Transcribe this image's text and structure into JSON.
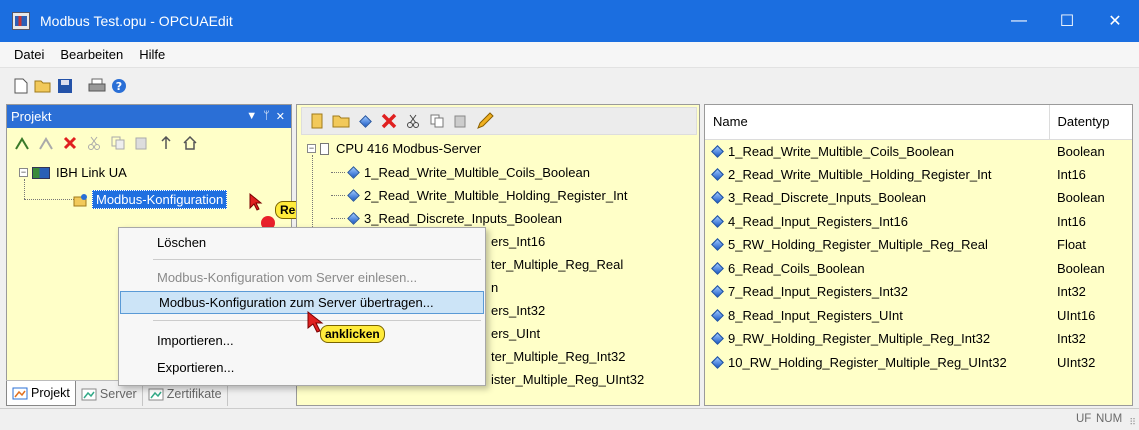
{
  "window": {
    "title": "Modbus Test.opu - OPCUAEdit",
    "minimize": "—",
    "maximize": "☐",
    "close": "✕"
  },
  "menu": [
    "Datei",
    "Bearbeiten",
    "Hilfe"
  ],
  "project_pane": {
    "title": "Projekt",
    "tree": {
      "root": "IBH Link UA",
      "child": "Modbus-Konfiguration"
    }
  },
  "bottom_tabs": [
    "Projekt",
    "Server",
    "Zertifikate"
  ],
  "server_tree": {
    "root": "CPU 416 Modbus-Server",
    "items": [
      "1_Read_Write_Multible_Coils_Boolean",
      "2_Read_Write_Multible_Holding_Register_Int",
      "3_Read_Discrete_Inputs_Boolean"
    ],
    "partial_items": [
      "ers_Int16",
      "ter_Multiple_Reg_Real",
      "n",
      "ers_Int32",
      "ers_UInt",
      "ter_Multiple_Reg_Int32",
      "ister_Multiple_Reg_UInt32"
    ]
  },
  "list_view": {
    "columns": [
      "Name",
      "Datentyp"
    ],
    "rows": [
      {
        "name": "1_Read_Write_Multible_Coils_Boolean",
        "type": "Boolean"
      },
      {
        "name": "2_Read_Write_Multible_Holding_Register_Int",
        "type": "Int16"
      },
      {
        "name": "3_Read_Discrete_Inputs_Boolean",
        "type": "Boolean"
      },
      {
        "name": "4_Read_Input_Registers_Int16",
        "type": "Int16"
      },
      {
        "name": "5_RW_Holding_Register_Multiple_Reg_Real",
        "type": "Float"
      },
      {
        "name": "6_Read_Coils_Boolean",
        "type": "Boolean"
      },
      {
        "name": "7_Read_Input_Registers_Int32",
        "type": "Int32"
      },
      {
        "name": "8_Read_Input_Registers_UInt",
        "type": "UInt16"
      },
      {
        "name": "9_RW_Holding_Register_Multiple_Reg_Int32",
        "type": "Int32"
      },
      {
        "name": "10_RW_Holding_Register_Multiple_Reg_UInt32",
        "type": "UInt32"
      }
    ]
  },
  "context_menu": {
    "delete": "Löschen",
    "read_from_server": "Modbus-Konfiguration vom Server einlesen...",
    "transfer_to_server": "Modbus-Konfiguration zum Server übertragen...",
    "import": "Importieren...",
    "export": "Exportieren..."
  },
  "callouts": {
    "right_click": "Rechtsklick",
    "click": "anklicken"
  },
  "status": {
    "uf": "UF",
    "num": "NUM"
  },
  "icons": [
    "app-icon",
    "new-file-icon",
    "open-folder-icon",
    "save-icon",
    "print-icon",
    "help-icon",
    "cut-icon",
    "copy-icon",
    "paste-icon",
    "delete-icon",
    "up-arrow-icon",
    "home-icon",
    "folder-icon",
    "variable-icon",
    "pencil-icon"
  ],
  "colors": {
    "titlebar": "#1b6ee0",
    "pane_bg": "#ffffc8",
    "callout": "#ffeb3b",
    "selection": "#1f6fe0"
  }
}
